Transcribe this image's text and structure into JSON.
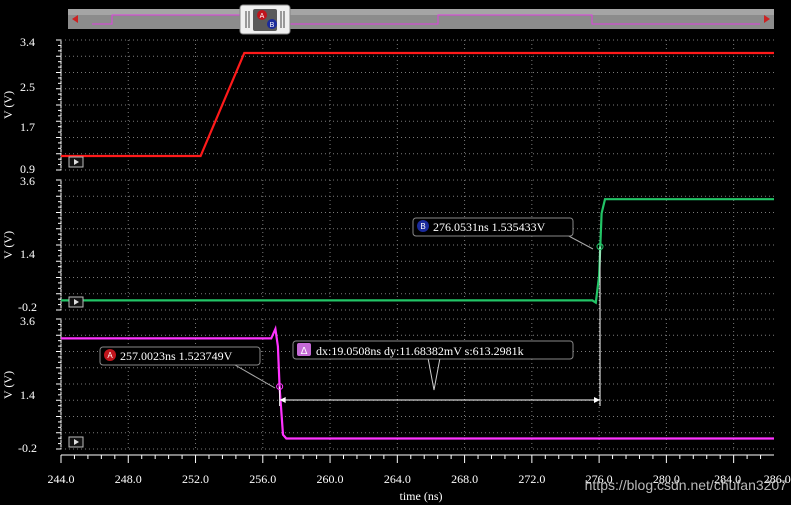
{
  "colors": {
    "background": "#000000",
    "grid": "#7a7a7a",
    "axis_text": "#ffffff",
    "overview_bg": "#8a8a8a",
    "marker_a": "#c0141c",
    "marker_b": "#1a2a9c",
    "delta_badge": "#c66ad6"
  },
  "overview": {
    "icon_name": "cursor-ab-handle-icon",
    "left_arrow_icon": "arrow-left-icon",
    "right_arrow_icon": "arrow-right-icon",
    "marker_a_letter": "A",
    "marker_b_letter": "B"
  },
  "chart_data": {
    "type": "line",
    "xlabel": "time (ns)",
    "x_ticks": [
      "244.0",
      "248.0",
      "252.0",
      "256.0",
      "260.0",
      "264.0",
      "268.0",
      "272.0",
      "276.0",
      "280.0",
      "284.0",
      "286.0"
    ],
    "xlim": [
      244.0,
      286.4
    ],
    "grid": true,
    "panels": [
      {
        "ylabel": "V (V)",
        "y_ticks": [
          "3.4",
          "2.5",
          "1.7",
          "0.9"
        ],
        "ylim": [
          0.9,
          3.4
        ],
        "series": [
          {
            "color": "#ff1a1a",
            "points": [
              [
                244.0,
                1.05
              ],
              [
                252.3,
                1.05
              ],
              [
                254.9,
                3.25
              ],
              [
                286.4,
                3.25
              ]
            ]
          }
        ]
      },
      {
        "ylabel": "V (V)",
        "y_ticks": [
          "3.6",
          "1.4",
          "-0.2"
        ],
        "ylim": [
          -0.2,
          3.6
        ],
        "series": [
          {
            "color": "#22c466",
            "points": [
              [
                244.0,
                -0.18
              ],
              [
                275.6,
                -0.18
              ],
              [
                275.8,
                -0.25
              ],
              [
                276.0,
                0.6
              ],
              [
                276.15,
                2.6
              ],
              [
                276.35,
                3.05
              ],
              [
                286.4,
                3.05
              ]
            ]
          }
        ],
        "marker": {
          "letter": "B",
          "x": 276.0531,
          "y": 1.535433,
          "label": "276.0531ns 1.535433V"
        }
      },
      {
        "ylabel": "V (V)",
        "y_ticks": [
          "3.6",
          "1.4",
          "-0.2"
        ],
        "ylim": [
          -0.2,
          3.6
        ],
        "series": [
          {
            "color": "#ff33ff",
            "points": [
              [
                244.0,
                3.05
              ],
              [
                256.5,
                3.05
              ],
              [
                256.75,
                3.35
              ],
              [
                256.9,
                2.8
              ],
              [
                257.0,
                1.5
              ],
              [
                257.2,
                0.0
              ],
              [
                257.4,
                -0.12
              ],
              [
                286.4,
                -0.12
              ]
            ]
          }
        ],
        "marker": {
          "letter": "A",
          "x": 257.0023,
          "y": 1.523749,
          "label": "257.0023ns 1.523749V"
        }
      }
    ],
    "delta": {
      "label": "dx:19.0508ns dy:11.68382mV s:613.2981k",
      "dx_ns": 19.0508,
      "dy_mV": 11.68382,
      "slope_k": 613.2981
    }
  },
  "watermark": "https://blog.csdn.net/chufan3207"
}
